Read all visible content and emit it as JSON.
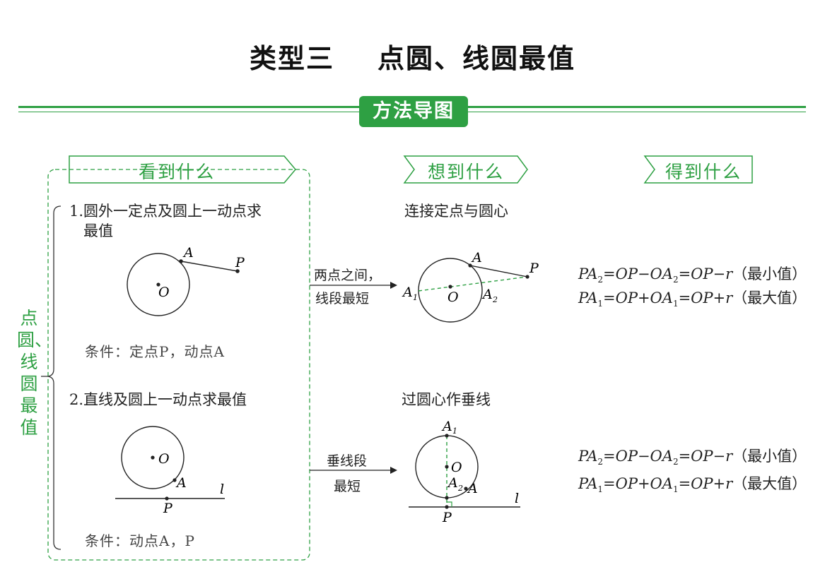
{
  "page": {
    "title": "类型三    点圆、线圆最值",
    "badge": "方法导图"
  },
  "columns": {
    "see": "看到什么",
    "think": "想到什么",
    "get": "得到什么"
  },
  "side_label": "点圆、线圆最值",
  "case1": {
    "heading_line1": "1.圆外一定点及圆上一动点求",
    "heading_line2": "最值",
    "condition": "条件：定点P，动点A",
    "think": "连接定点与圆心",
    "arrow_line1": "两点之间，",
    "arrow_line2": "线段最短",
    "labels": {
      "A": "A",
      "P": "P",
      "O": "O",
      "A1": "A",
      "A1_sub": "1",
      "A2": "A",
      "A2_sub": "2"
    },
    "result_min": {
      "lhs": "PA",
      "lhs_sub": "2",
      "mid": "=OP−OA",
      "mid_sub": "2",
      "rhs": "=OP−r",
      "note": "（最小值）"
    },
    "result_max": {
      "lhs": "PA",
      "lhs_sub": "1",
      "mid": "=OP+OA",
      "mid_sub": "1",
      "rhs": "=OP+r",
      "note": "（最大值）"
    }
  },
  "case2": {
    "heading": "2.直线及圆上一动点求最值",
    "condition": "条件：动点A，P",
    "think": "过圆心作垂线",
    "arrow_line1": "垂线段",
    "arrow_line2": "最短",
    "labels": {
      "A": "A",
      "P": "P",
      "O": "O",
      "l": "l",
      "A1": "A",
      "A1_sub": "1",
      "A2": "A",
      "A2_sub": "2"
    },
    "result_min": {
      "lhs": "PA",
      "lhs_sub": "2",
      "mid": "=OP−OA",
      "mid_sub": "2",
      "rhs": "=OP−r",
      "note": "（最小值）"
    },
    "result_max": {
      "lhs": "PA",
      "lhs_sub": "1",
      "mid": "=OP+OA",
      "mid_sub": "1",
      "rhs": "=OP+r",
      "note": "（最大值）"
    }
  },
  "colors": {
    "accent": "#2ea043"
  }
}
